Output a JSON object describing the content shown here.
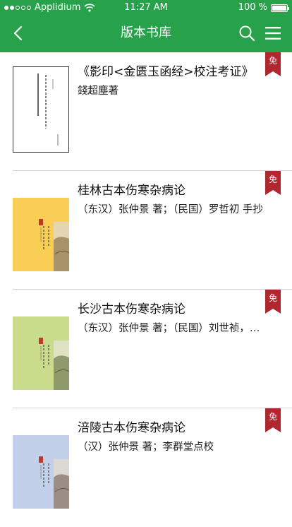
{
  "status_bar": {
    "carrier": "Applidium",
    "time": "11:27 AM",
    "battery": "100 %"
  },
  "header": {
    "title": "版本书库"
  },
  "books": [
    {
      "title": "《影印<金匮玉函经>校注考证》",
      "author": "錢超塵著",
      "badge": "免"
    },
    {
      "title": "桂林古本伤寒杂病论",
      "author": "（东汉）张仲景 著；（民国）罗哲初 手抄",
      "badge": "免"
    },
    {
      "title": "长沙古本伤寒杂病论",
      "author": "（东汉）张仲景 著；（民国）刘世祯，刘瑞瀜 述",
      "badge": "免"
    },
    {
      "title": "涪陵古本伤寒杂病论",
      "author": "（汉）张仲景 著；李群堂点校",
      "badge": "免"
    }
  ],
  "colors": {
    "header": "#27a14a",
    "badge": "#b0282e"
  }
}
